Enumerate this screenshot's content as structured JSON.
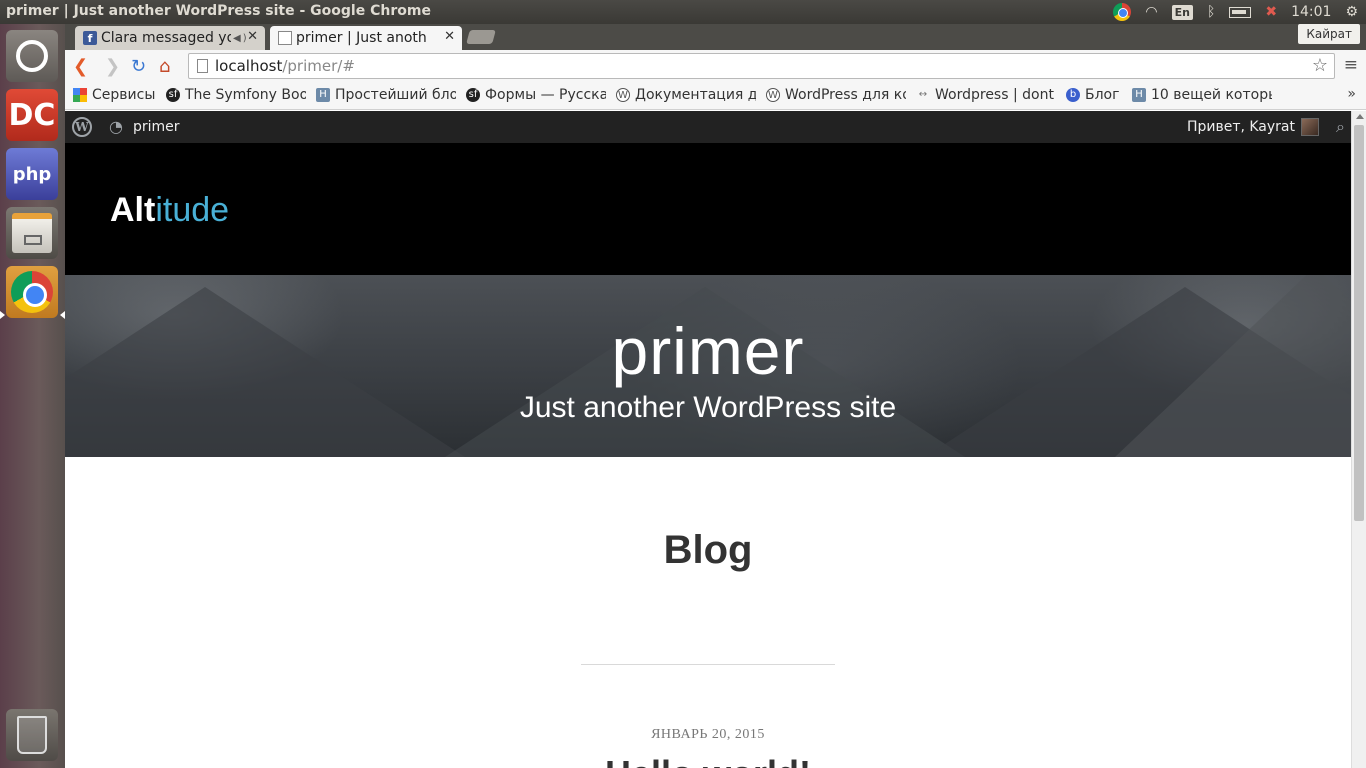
{
  "os_panel": {
    "window_title": "primer | Just another WordPress site - Google Chrome",
    "lang": "En",
    "clock": "14:01"
  },
  "launcher": {
    "items": [
      "ubuntu-dash-icon",
      "dreamweaver-icon",
      "phpstorm-icon",
      "files-icon",
      "chrome-icon",
      "trash-icon"
    ],
    "dc_label": "DC",
    "php_label": "php"
  },
  "tabs": [
    {
      "title": "Clara messaged you",
      "favicon": "f",
      "active": false
    },
    {
      "title": "primer | Just another WordPress site",
      "active": true
    }
  ],
  "profile_name": "Кайрат",
  "address": {
    "host": "localhost",
    "path": "/primer/#"
  },
  "bookmarks": [
    "Сервисы",
    "The Symfony Boo",
    "Простейший бло",
    "Формы — Русска",
    "Документация д",
    "WordPress для ко",
    "Wordpress | dont",
    "Блог",
    "10 вещей которь"
  ],
  "bookmarks_more": "»",
  "wp_admin_bar": {
    "site_name": "primer",
    "greeting": "Привет, Kayrat"
  },
  "site": {
    "logo_bold": "Alt",
    "logo_light": "itude",
    "hero_title": "primer",
    "hero_tagline": "Just another WordPress site",
    "page_title": "Blog",
    "post_date": "ЯНВАРЬ 20, 2015",
    "post_title": "Hello world!"
  },
  "colors": {
    "logo_accent": "#49b0d6",
    "wp_bar": "#222222",
    "header_bg": "#000000"
  }
}
